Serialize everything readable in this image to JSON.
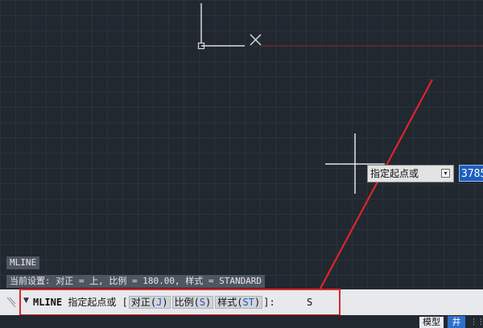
{
  "dynamic_input": {
    "prompt": "指定起点或",
    "coordinate_value": "3785"
  },
  "command_history": {
    "line1": "MLINE",
    "line2": "当前设置: 对正 = 上, 比例 = 180.00, 样式 = STANDARD"
  },
  "command_line": {
    "command": "MLINE",
    "prompt": "指定起点或",
    "bracket_open": "[",
    "bracket_close": "]:",
    "options": [
      {
        "label": "对正",
        "key": "J"
      },
      {
        "label": "比例",
        "key": "S"
      },
      {
        "label": "样式",
        "key": "ST"
      }
    ],
    "input_value": "S"
  },
  "status_bar": {
    "model_tab": "模型",
    "grid_label": "井"
  },
  "colors": {
    "background": "#212830",
    "annotation_red": "#e0242b",
    "accent_blue": "#1c5fbf"
  }
}
